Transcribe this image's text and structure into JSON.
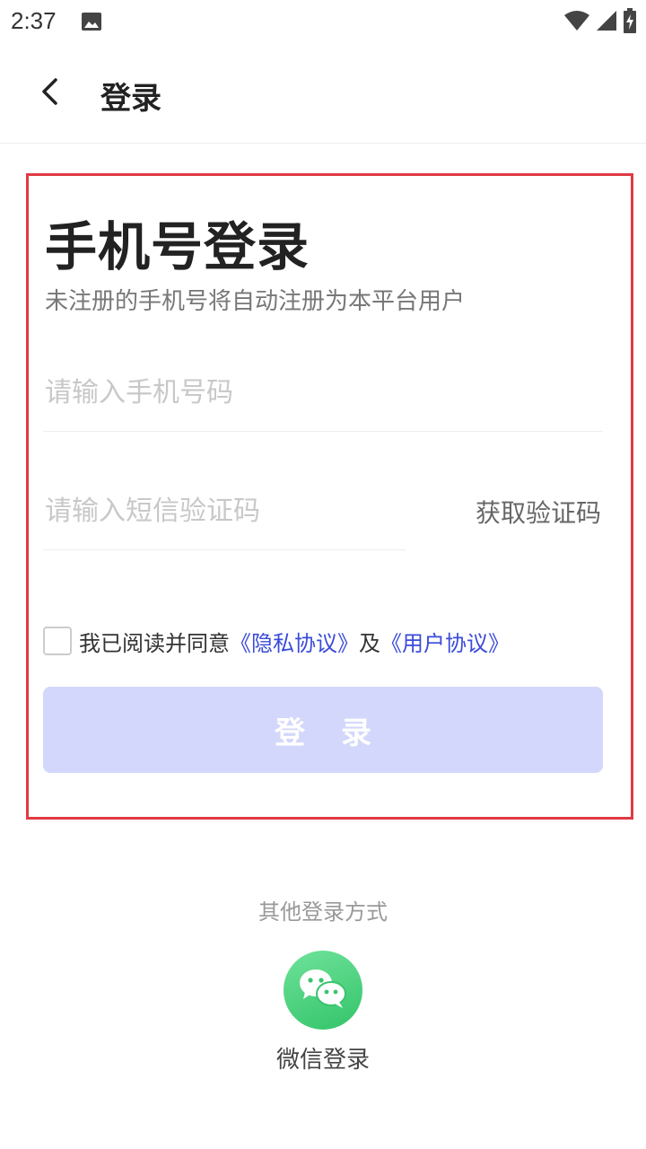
{
  "status_bar": {
    "time": "2:37",
    "icons": [
      "image-icon",
      "wifi-icon",
      "signal-icon",
      "battery-charging-icon"
    ]
  },
  "app_bar": {
    "title": "登录",
    "back_icon": "chevron-left-icon"
  },
  "form": {
    "title": "手机号登录",
    "subtitle": "未注册的手机号将自动注册为本平台用户",
    "phone_placeholder": "请输入手机号码",
    "phone_value": "",
    "code_placeholder": "请输入短信验证码",
    "code_value": "",
    "get_code_label": "获取验证码",
    "agreement_checked": false,
    "agreement_prefix": "我已阅读并同意",
    "privacy_link": "《隐私协议》",
    "agreement_and": "及",
    "user_link": "《用户协议》",
    "login_label": "登录",
    "login_button_color": "#d3d7fb",
    "link_color": "#3a4bd8",
    "highlight_border_color": "#e03a45"
  },
  "other_login": {
    "label": "其他登录方式",
    "wechat_label": "微信登录",
    "wechat_icon": "wechat-icon",
    "wechat_color": "#3ac46d"
  }
}
